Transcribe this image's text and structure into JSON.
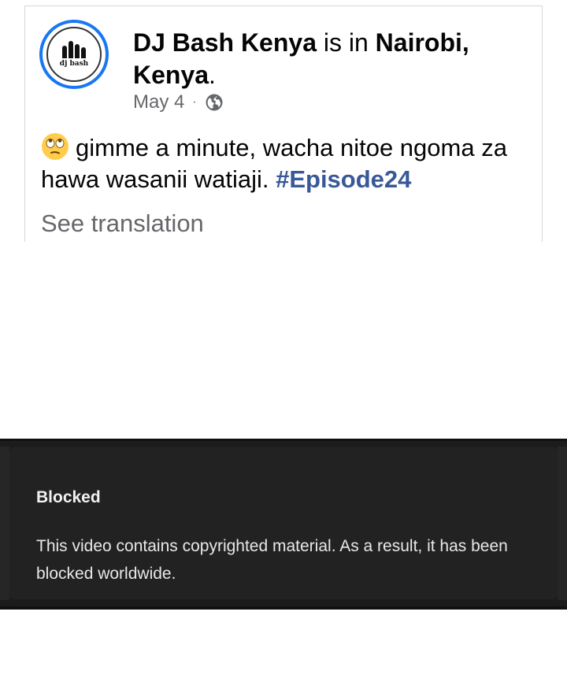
{
  "post": {
    "author": "DJ Bash Kenya",
    "connector": " is in ",
    "location": "Nairobi, Kenya",
    "trailing": ".",
    "date": "May 4",
    "separator": "·",
    "privacy_icon": "globe-icon",
    "emoji": "face-with-rolling-eyes",
    "text": "gimme a minute, wacha nitoe ngoma za hawa wasanii watiaji. ",
    "hashtag": "#Episode24",
    "see_translation": "See translation",
    "avatar_logo_text": "dj bash"
  },
  "video": {
    "title": "Blocked",
    "message": "This video contains copyrighted material. As a result, it has been blocked worldwide."
  },
  "colors": {
    "avatar_ring": "#1877f2",
    "hashtag": "#385898",
    "meta_gray": "#65676b",
    "video_bg": "#222222"
  }
}
